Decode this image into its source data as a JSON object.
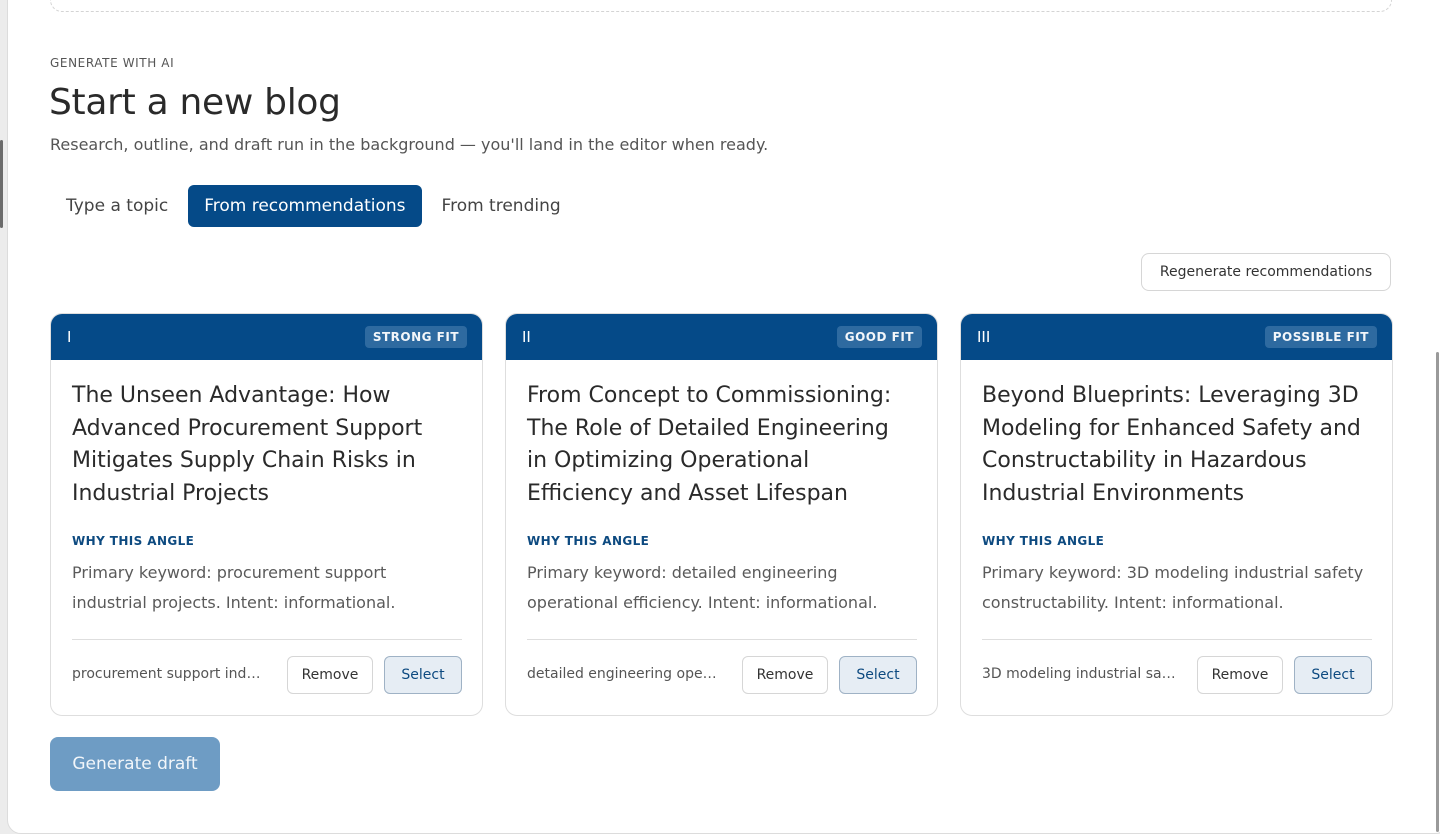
{
  "header": {
    "eyebrow": "GENERATE WITH AI",
    "title": "Start a new blog",
    "subtitle": "Research, outline, and draft run in the background — you'll land in the editor when ready."
  },
  "tabs": [
    {
      "label": "Type a topic",
      "active": false
    },
    {
      "label": "From recommendations",
      "active": true
    },
    {
      "label": "From trending",
      "active": false
    }
  ],
  "regenerate_label": "Regenerate recommendations",
  "cards": [
    {
      "numeral": "I",
      "fit": "STRONG FIT",
      "title": "The Unseen Advantage: How Advanced Procurement Support Mitigates Supply Chain Risks in Industrial Projects",
      "why_label": "WHY THIS ANGLE",
      "why_text": "Primary keyword: procurement support industrial projects. Intent: informational.",
      "keyword": "procurement support industrial projects",
      "remove_label": "Remove",
      "select_label": "Select"
    },
    {
      "numeral": "II",
      "fit": "GOOD FIT",
      "title": "From Concept to Commissioning: The Role of Detailed Engineering in Optimizing Operational Efficiency and Asset Lifespan",
      "why_label": "WHY THIS ANGLE",
      "why_text": "Primary keyword: detailed engineering operational efficiency. Intent: informational.",
      "keyword": "detailed engineering operational efficiency",
      "remove_label": "Remove",
      "select_label": "Select"
    },
    {
      "numeral": "III",
      "fit": "POSSIBLE FIT",
      "title": "Beyond Blueprints: Leveraging 3D Modeling for Enhanced Safety and Constructability in Hazardous Industrial Environments",
      "why_label": "WHY THIS ANGLE",
      "why_text": "Primary keyword: 3D modeling industrial safety constructability. Intent: informational.",
      "keyword": "3D modeling industrial safety constructability",
      "remove_label": "Remove",
      "select_label": "Select"
    }
  ],
  "generate_label": "Generate draft",
  "colors": {
    "brand": "#054a88",
    "generate_disabled": "#6e9cc4",
    "select_bg": "#e6edf4"
  }
}
